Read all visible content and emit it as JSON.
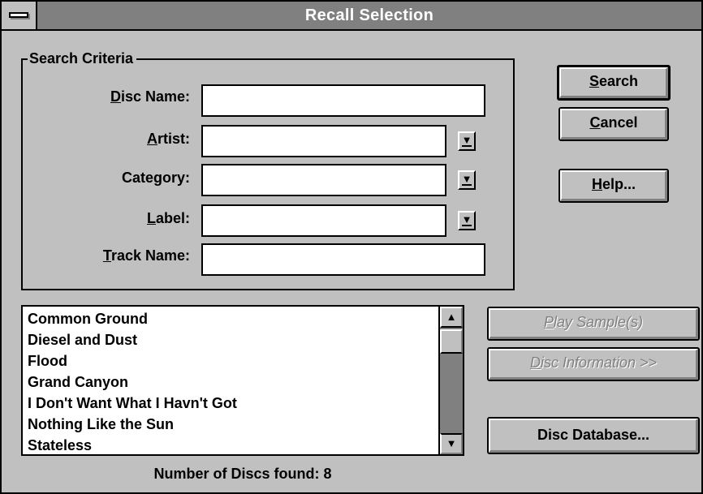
{
  "window": {
    "title": "Recall Selection"
  },
  "search_criteria": {
    "legend": "Search Criteria",
    "disc_name": {
      "label_pre": "",
      "label_hot": "D",
      "label_post": "isc Name:",
      "value": ""
    },
    "artist": {
      "label_pre": "",
      "label_hot": "A",
      "label_post": "rtist:",
      "value": ""
    },
    "category": {
      "label_pre": "Cate",
      "label_hot": "g",
      "label_post": "ory:",
      "value": ""
    },
    "label": {
      "label_pre": "",
      "label_hot": "L",
      "label_post": "abel:",
      "value": ""
    },
    "track_name": {
      "label_pre": "",
      "label_hot": "T",
      "label_post": "rack Name:",
      "value": ""
    }
  },
  "buttons": {
    "search": {
      "hot": "S",
      "rest": "earch"
    },
    "cancel": {
      "hot": "C",
      "rest": "ancel"
    },
    "help": {
      "hot": "H",
      "rest": "elp..."
    },
    "play_sample": {
      "hot": "P",
      "rest": "lay Sample(s)"
    },
    "disc_info": {
      "hot": "D",
      "rest": "isc Information >>"
    },
    "disc_database": "Disc Database..."
  },
  "results": {
    "items": [
      "Common Ground",
      "Diesel and Dust",
      "Flood",
      "Grand Canyon",
      "I Don't Want What I Havn't Got",
      "Nothing Like the Sun",
      "Stateless"
    ],
    "status_text": "Number of Discs found:  8"
  },
  "icons": {
    "dropdown": "arrow-down-underlined",
    "scroll_up": "arrow-up",
    "scroll_down": "arrow-down"
  }
}
